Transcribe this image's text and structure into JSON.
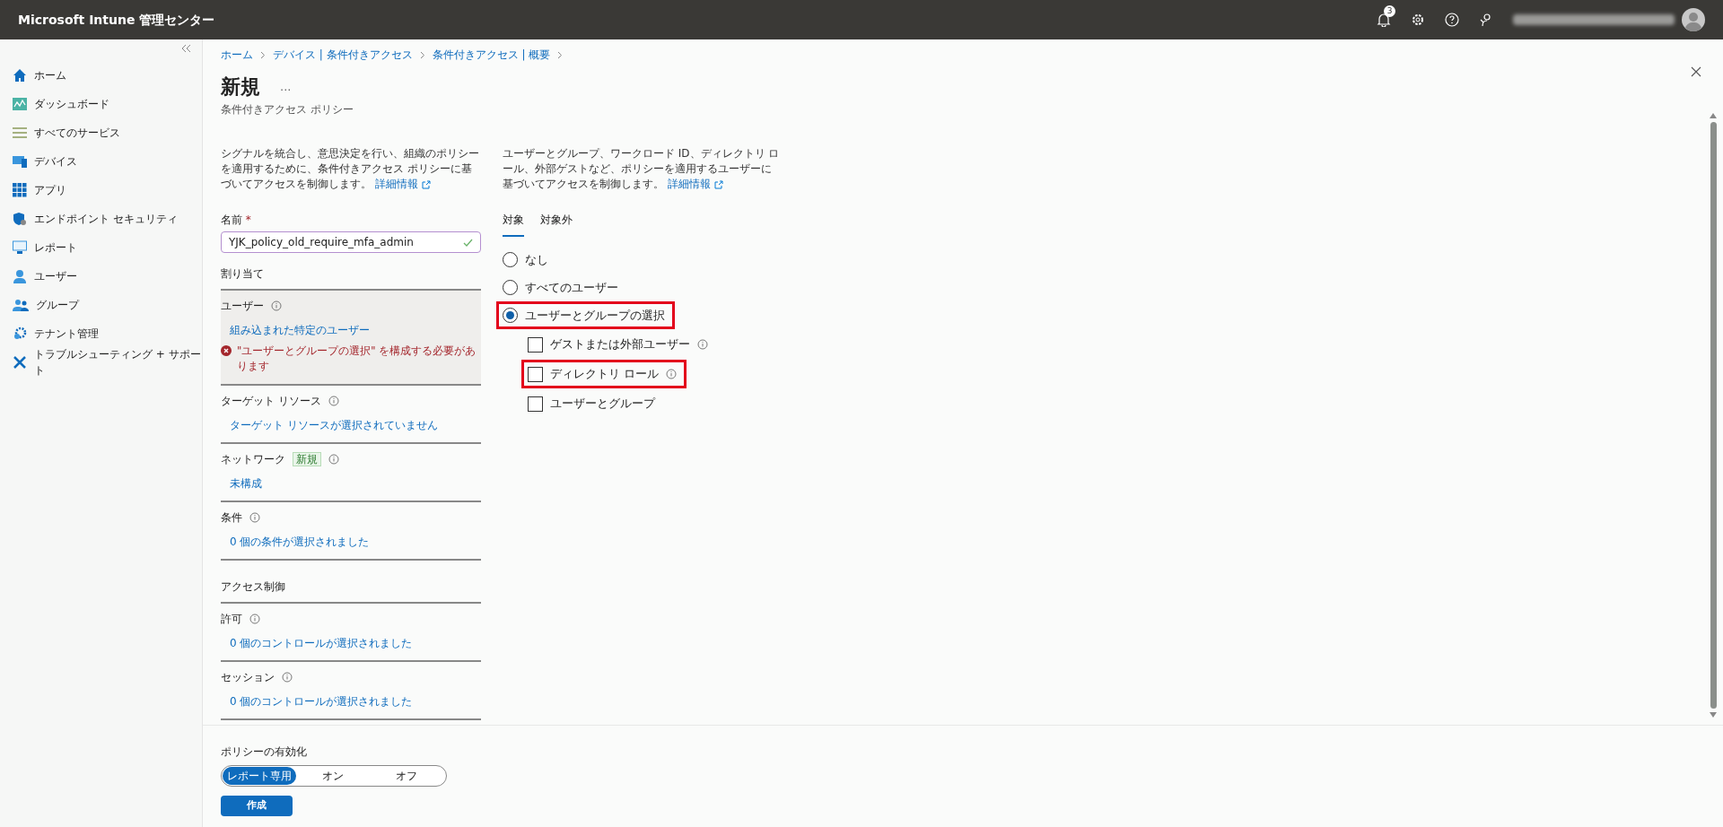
{
  "top_bar": {
    "title": "Microsoft Intune 管理センター",
    "notification_count": "3"
  },
  "sidebar": {
    "items": [
      {
        "label": "ホーム",
        "selected": false
      },
      {
        "label": "ダッシュボード",
        "selected": false
      },
      {
        "label": "すべてのサービス",
        "selected": false
      },
      {
        "label": "デバイス",
        "selected": false
      },
      {
        "label": "アプリ",
        "selected": false
      },
      {
        "label": "エンドポイント セキュリティ",
        "selected": false
      },
      {
        "label": "レポート",
        "selected": false
      },
      {
        "label": "ユーザー",
        "selected": false
      },
      {
        "label": "グループ",
        "selected": false
      },
      {
        "label": "テナント管理",
        "selected": false
      },
      {
        "label": "トラブルシューティング + サポート",
        "selected": false
      }
    ]
  },
  "breadcrumb": [
    "ホーム",
    "デバイス | 条件付きアクセス",
    "条件付きアクセス | 概要"
  ],
  "page": {
    "title": "新規",
    "more": "...",
    "subtitle": "条件付きアクセス ポリシー"
  },
  "left": {
    "description": "シグナルを統合し、意思決定を行い、組織のポリシーを適用するために、条件付きアクセス ポリシーに基づいてアクセスを制御します。",
    "learn_more": "詳細情報",
    "name_label": "名前",
    "required_mark": "*",
    "name_value": "YJK_policy_old_require_mfa_admin",
    "name_valid": true,
    "groups": [
      {
        "heading": "割り当て",
        "sections": [
          {
            "label": "ユーザー",
            "value": "組み込まれた特定のユーザー",
            "selected": true,
            "error": "\"ユーザーとグループの選択\" を構成する必要があります"
          },
          {
            "label": "ターゲット リソース",
            "value": "ターゲット リソースが選択されていません",
            "selected": false
          },
          {
            "label": "ネットワーク",
            "badge": "新規",
            "value": "未構成",
            "selected": false
          },
          {
            "label": "条件",
            "value": "0 個の条件が選択されました",
            "selected": false
          }
        ]
      },
      {
        "heading": "アクセス制御",
        "sections": [
          {
            "label": "許可",
            "value": "0 個のコントロールが選択されました",
            "selected": false
          },
          {
            "label": "セッション",
            "value": "0 個のコントロールが選択されました",
            "selected": false
          }
        ]
      }
    ]
  },
  "right": {
    "description": "ユーザーとグループ、ワークロード ID、ディレクトリ ロール、外部ゲストなど、ポリシーを適用するユーザーに基づいてアクセスを制御します。",
    "learn_more": "詳細情報",
    "tabs": [
      {
        "label": "対象",
        "selected": true
      },
      {
        "label": "対象外",
        "selected": false
      }
    ],
    "options": [
      {
        "kind": "radio",
        "label": "なし",
        "selected": false,
        "highlighted": false
      },
      {
        "kind": "radio",
        "label": "すべてのユーザー",
        "selected": false,
        "highlighted": false
      },
      {
        "kind": "radio",
        "label": "ユーザーとグループの選択",
        "selected": true,
        "highlighted": true
      },
      {
        "kind": "checkbox",
        "label": "ゲストまたは外部ユーザー",
        "checked": false,
        "info": true,
        "highlighted": false
      },
      {
        "kind": "checkbox",
        "label": "ディレクトリ ロール",
        "checked": false,
        "info": true,
        "highlighted": true
      },
      {
        "kind": "checkbox",
        "label": "ユーザーとグループ",
        "checked": false,
        "info": false,
        "highlighted": false
      }
    ]
  },
  "footer": {
    "label": "ポリシーの有効化",
    "toggle": [
      {
        "label": "レポート専用",
        "selected": true
      },
      {
        "label": "オン",
        "selected": false
      },
      {
        "label": "オフ",
        "selected": false
      }
    ],
    "create": "作成"
  }
}
